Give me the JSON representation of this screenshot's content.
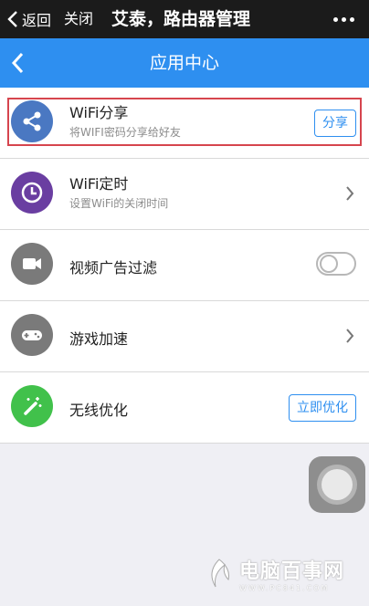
{
  "wechat_bar": {
    "back_label": "返回",
    "close_label": "关闭",
    "title": "艾泰，路由器管理"
  },
  "header": {
    "title": "应用中心"
  },
  "items": [
    {
      "title": "WiFi分享",
      "subtitle": "将WIFI密码分享给好友",
      "icon": "share-icon",
      "icon_bg": "#4a78c2",
      "action": "button",
      "action_label": "分享",
      "highlighted": true
    },
    {
      "title": "WiFi定时",
      "subtitle": "设置WiFi的关闭时间",
      "icon": "clock-icon",
      "icon_bg": "#6a3ea1",
      "action": "chevron"
    },
    {
      "title": "视频广告过滤",
      "icon": "video-camera-icon",
      "icon_bg": "#7a7a7a",
      "action": "toggle",
      "toggle_on": false
    },
    {
      "title": "游戏加速",
      "icon": "gamepad-icon",
      "icon_bg": "#7a7a7a",
      "action": "chevron"
    },
    {
      "title": "无线优化",
      "icon": "magic-wand-icon",
      "icon_bg": "#41c14b",
      "action": "button",
      "action_label": "立即优化"
    }
  ],
  "watermark": {
    "text": "电脑百事网",
    "url": "WWW.PC841.COM"
  }
}
